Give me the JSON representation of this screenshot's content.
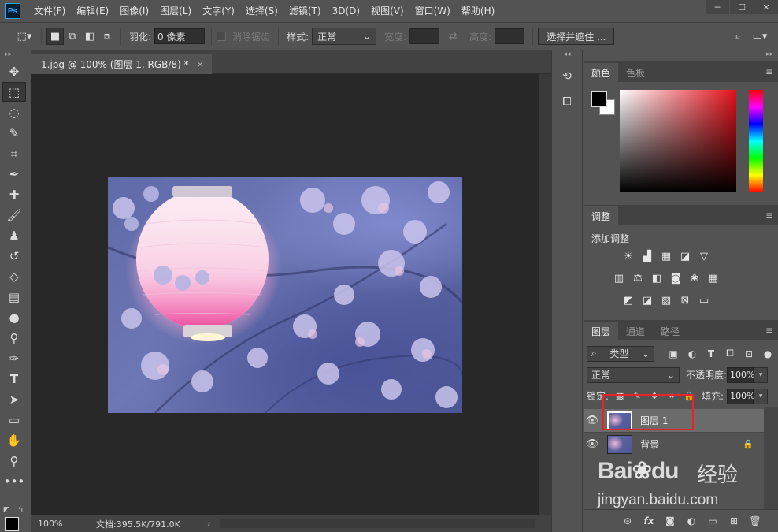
{
  "app": {
    "logo": "Ps"
  },
  "menu": [
    "文件(F)",
    "编辑(E)",
    "图像(I)",
    "图层(L)",
    "文字(Y)",
    "选择(S)",
    "滤镜(T)",
    "3D(D)",
    "视图(V)",
    "窗口(W)",
    "帮助(H)"
  ],
  "window_controls": {
    "minimize": "─",
    "maximize": "☐",
    "close": "✕"
  },
  "options": {
    "feather_label": "羽化:",
    "feather_value": "0 像素",
    "antialias_label": "消除锯齿",
    "style_label": "样式:",
    "style_value": "正常",
    "width_label": "宽度:",
    "height_label": "高度:",
    "select_mask_button": "选择并遮住 ..."
  },
  "document": {
    "tab_title": "1.jpg @ 100% (图层 1, RGB/8) *",
    "tab_close": "×",
    "status_zoom": "100%",
    "status_info": "文档:395.5K/791.0K",
    "status_arrow": "›"
  },
  "panels": {
    "color_tabs": [
      "颜色",
      "色板"
    ],
    "adjust_tab": "调整",
    "adjust_title": "添加调整",
    "layers_tabs": [
      "图层",
      "通道",
      "路径"
    ],
    "filter_kind": "类型",
    "blend_mode": "正常",
    "opacity_label": "不透明度:",
    "opacity_value": "100%",
    "lock_label": "锁定:",
    "fill_label": "填充:",
    "fill_value": "100%"
  },
  "layers": [
    {
      "name": "图层 1",
      "selected": true
    },
    {
      "name": "背景",
      "selected": false,
      "locked": true
    }
  ],
  "watermark": {
    "brand_a": "Bai",
    "brand_b": "du",
    "cn": "经验",
    "url": "jingyan.baidu.com"
  },
  "colors": {
    "foreground": "#000000",
    "background": "#ffffff",
    "highlight": "#e8232a"
  }
}
